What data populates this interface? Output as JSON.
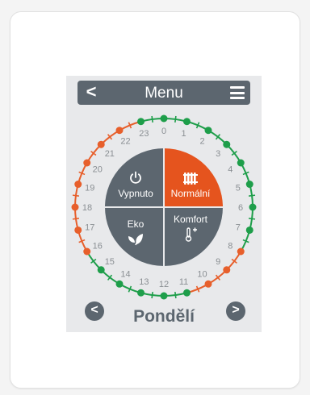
{
  "header": {
    "back_symbol": "<",
    "title": "Menu",
    "menu_icon": "hamburger-icon"
  },
  "dial": {
    "hours": [
      "0",
      "1",
      "2",
      "3",
      "4",
      "5",
      "6",
      "7",
      "8",
      "9",
      "10",
      "11",
      "12",
      "13",
      "14",
      "15",
      "16",
      "17",
      "18",
      "19",
      "20",
      "21",
      "22",
      "23"
    ],
    "segments": [
      "green",
      "green",
      "green",
      "green",
      "green",
      "green",
      "green",
      "green",
      "orange",
      "orange",
      "orange",
      "green",
      "green",
      "green",
      "green",
      "green",
      "orange",
      "orange",
      "orange",
      "orange",
      "orange",
      "orange",
      "orange",
      "green"
    ],
    "colors": {
      "green": "#1e9e4a",
      "orange": "#e75f2b",
      "quad_gray": "#5c666f",
      "quad_accent": "#e5541e",
      "label": "#8a8f93"
    }
  },
  "modes": {
    "off": {
      "label": "Vypnuto",
      "icon": "power-icon"
    },
    "normal": {
      "label": "Normální",
      "icon": "radiator-icon",
      "active": true
    },
    "eco": {
      "label": "Eko",
      "icon": "leaf-icon"
    },
    "comfort": {
      "label": "Komfort",
      "icon": "thermometer-plus-icon"
    }
  },
  "footer": {
    "day": "Pondělí",
    "prev_symbol": "<",
    "next_symbol": ">"
  }
}
